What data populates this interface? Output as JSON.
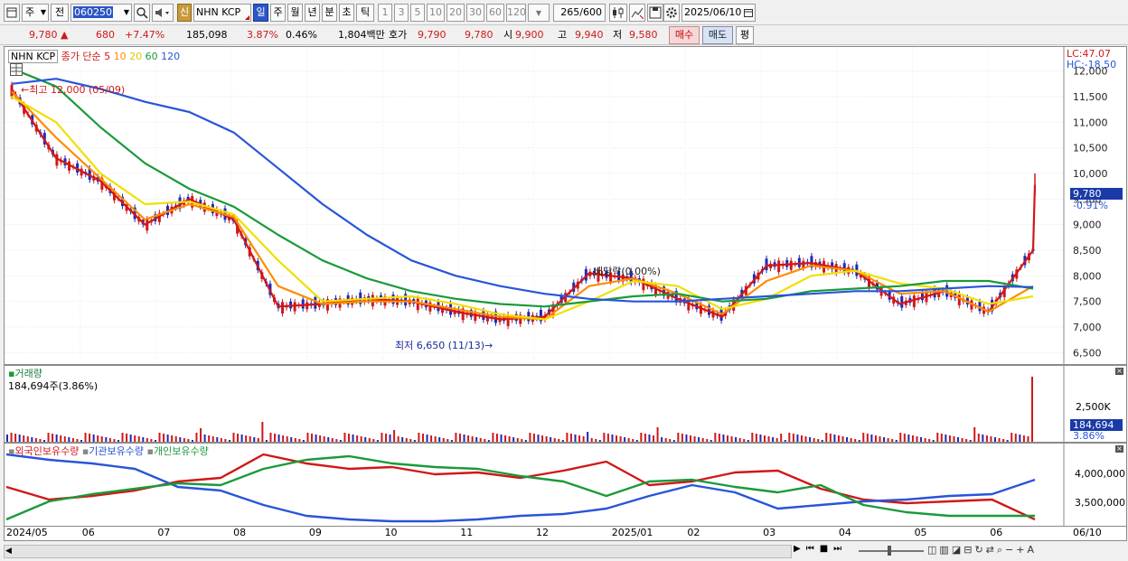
{
  "toolbar": {
    "period_label": "주",
    "prev_label": "전",
    "code": "060250",
    "credit_badge": "신",
    "stock_name": "NHN KCP",
    "periods": [
      "일",
      "주",
      "월",
      "년",
      "분",
      "초",
      "틱"
    ],
    "selected_period": "일",
    "intervals": [
      "1",
      "3",
      "5",
      "10",
      "20",
      "30",
      "60",
      "120"
    ],
    "count": "265",
    "count_total": "/600",
    "date": "2025/06/10"
  },
  "quote": {
    "price": "9,780",
    "change": "680",
    "change_pct": "+7.47%",
    "volume": "185,098",
    "volume_pct": "3.87%",
    "turnover_pct": "0.46%",
    "amount": "1,804백만",
    "ask_label": "호가",
    "ask1": "9,790",
    "ask2": "9,780",
    "open_label": "시",
    "open": "9,900",
    "high_label": "고",
    "high": "9,940",
    "low_label": "저",
    "low": "9,580",
    "buy_label": "매수",
    "sell_label": "매도",
    "eval_label": "평"
  },
  "price_panel": {
    "legend_name": "NHN KCP",
    "legend_ma_label": "종가 단순",
    "ma_periods": [
      "5",
      "10",
      "20",
      "60",
      "120"
    ],
    "lc_label": "LC:47.07",
    "hc_label": "HC:-18.50",
    "high_annotation": "최고 12,000 (05/09)",
    "low_annotation": "최저 6,650 (11/13)",
    "dividend_annotation": "배당락(0.00%)",
    "current_tag": "9,780",
    "current_change": "-0.91%",
    "y_ticks": [
      "12,000",
      "11,500",
      "11,000",
      "10,500",
      "10,000",
      "9,500",
      "9,000",
      "8,500",
      "8,000",
      "7,500",
      "7,000",
      "6,500"
    ],
    "y_values": [
      12000,
      11500,
      11000,
      10500,
      10000,
      9500,
      9000,
      8500,
      8000,
      7500,
      7000,
      6500
    ]
  },
  "volume_panel": {
    "title": "거래량",
    "value_label": "184,694주(3.86%)",
    "y_tick": "2,500K",
    "current_tag": "184,694",
    "current_pct": "3.86%"
  },
  "holding_panel": {
    "legend": [
      "외국인보유수량",
      "기관보유수량",
      "개인보유수량"
    ],
    "y_ticks": [
      "4,000,000",
      "3,500,000"
    ]
  },
  "x_axis": {
    "labels": [
      "2024/05",
      "06",
      "07",
      "08",
      "09",
      "10",
      "11",
      "12",
      "2025/01",
      "02",
      "03",
      "04",
      "05",
      "06",
      "06/10"
    ]
  },
  "chart_data": {
    "type": "candlestick",
    "title": "NHN KCP",
    "x": [
      "2024/05",
      "06",
      "07",
      "08",
      "09",
      "10",
      "11",
      "12",
      "2025/01",
      "02",
      "03",
      "04",
      "05",
      "06"
    ],
    "ylim": [
      6400,
      12400
    ],
    "series": [
      {
        "name": "종가 단순 5",
        "color": "#d01818",
        "values": [
          11650,
          10300,
          9850,
          9000,
          9500,
          9100,
          7400,
          7450,
          7550,
          7500,
          7300,
          7150,
          7200,
          8050,
          7950,
          7550,
          7200,
          8200,
          8250,
          8100,
          7450,
          7700,
          7300,
          8500
        ]
      },
      {
        "name": "10",
        "color": "#ff8c00",
        "values": [
          11600,
          10700,
          9900,
          9100,
          9400,
          9150,
          7800,
          7450,
          7500,
          7500,
          7350,
          7200,
          7150,
          7800,
          7950,
          7650,
          7250,
          7900,
          8200,
          8100,
          7650,
          7700,
          7300,
          7800
        ]
      },
      {
        "name": "20",
        "color": "#f0e000",
        "values": [
          11500,
          11000,
          10000,
          9400,
          9450,
          9200,
          8300,
          7500,
          7550,
          7600,
          7450,
          7250,
          7150,
          7500,
          7900,
          7800,
          7350,
          7550,
          8000,
          8100,
          7850,
          7750,
          7450,
          7600
        ]
      },
      {
        "name": "60",
        "color": "#1a9a3a",
        "values": [
          12050,
          11700,
          10900,
          10200,
          9700,
          9350,
          8800,
          8300,
          7950,
          7700,
          7550,
          7450,
          7400,
          7500,
          7600,
          7650,
          7500,
          7550,
          7700,
          7750,
          7800,
          7900,
          7900,
          7750
        ]
      },
      {
        "name": "120",
        "color": "#2855d8",
        "values": [
          11750,
          11850,
          11650,
          11400,
          11200,
          10800,
          10100,
          9400,
          8800,
          8300,
          8000,
          7800,
          7650,
          7550,
          7500,
          7500,
          7550,
          7600,
          7650,
          7700,
          7700,
          7750,
          7800,
          7780
        ]
      }
    ],
    "last_close": 9780,
    "last_volume": 184694,
    "high": {
      "value": 12000,
      "date": "05/09"
    },
    "low": {
      "value": 6650,
      "date": "11/13"
    }
  }
}
